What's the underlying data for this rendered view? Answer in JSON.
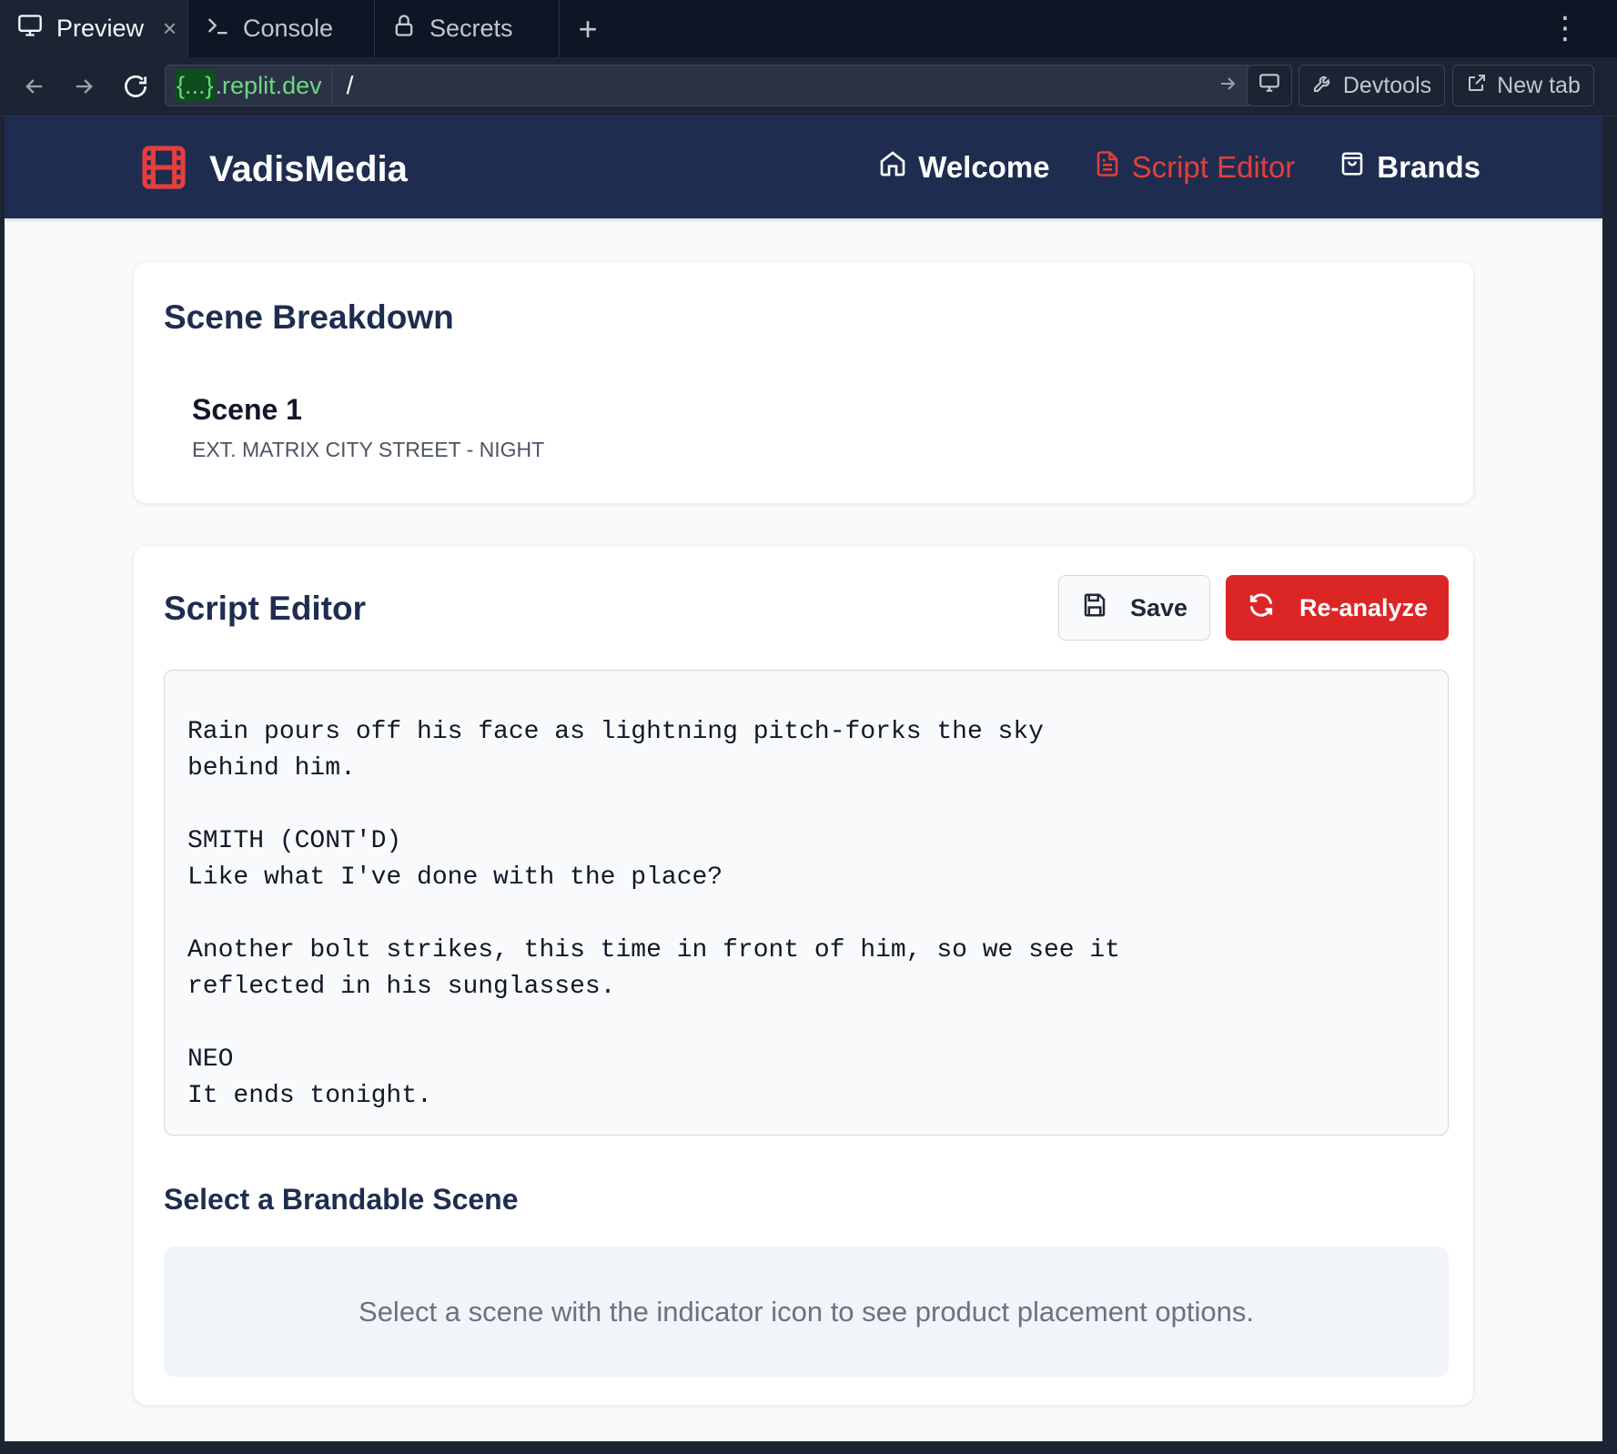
{
  "tabs": [
    {
      "label": "Preview",
      "icon": "monitor-icon",
      "active": true
    },
    {
      "label": "Console",
      "icon": "terminal-icon",
      "active": false
    },
    {
      "label": "Secrets",
      "icon": "lock-icon",
      "active": false
    }
  ],
  "address": {
    "host_prefix": "{...}",
    "host_suffix": ".replit.dev",
    "path": "/"
  },
  "chrome_buttons": {
    "devtools": "Devtools",
    "new_tab": "New tab"
  },
  "app": {
    "brand": "VadisMedia",
    "nav": [
      {
        "label": "Welcome",
        "icon": "home-icon",
        "active": false
      },
      {
        "label": "Script Editor",
        "icon": "file-text-icon",
        "active": true
      },
      {
        "label": "Brands",
        "icon": "shopping-bag-icon",
        "active": false
      }
    ],
    "accent": "#e53e3e",
    "navbar_color": "#1e2d4f"
  },
  "breakdown": {
    "title": "Scene Breakdown",
    "scene_title": "Scene 1",
    "scene_slug": "EXT. MATRIX CITY STREET - NIGHT"
  },
  "editor": {
    "title": "Script Editor",
    "save_label": "Save",
    "reanalyze_label": "Re-analyze",
    "content": "y\n\nRain pours off his face as lightning pitch-forks the sky\nbehind him.\n\nSMITH (CONT'D)\nLike what I've done with the place?\n\nAnother bolt strikes, this time in front of him, so we see it\nreflected in his sunglasses.\n\nNEO\nIt ends tonight."
  },
  "brandable": {
    "title": "Select a Brandable Scene",
    "empty_message": "Select a scene with the indicator icon to see product placement options."
  }
}
